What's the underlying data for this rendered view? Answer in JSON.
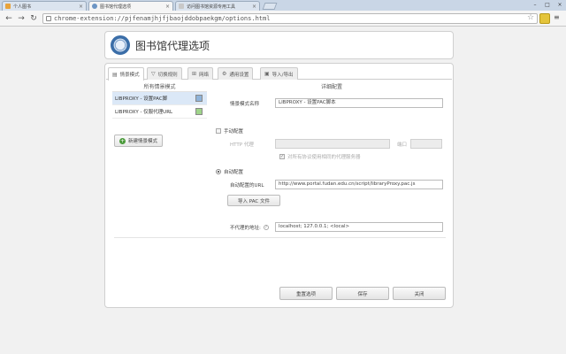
{
  "browser": {
    "tabs": [
      {
        "label": "个人图书"
      },
      {
        "label": "图书馆代理选项"
      },
      {
        "label": "访问图书馆资源专用工具"
      }
    ],
    "active_tab": 1,
    "url": "chrome-extension://pjfenamjhjfjbaojddobpaekgm/options.html"
  },
  "header": {
    "title": "图书馆代理选项"
  },
  "tabs": [
    {
      "label": "情景模式",
      "icon": "list-icon"
    },
    {
      "label": "切换规则",
      "icon": "filter-icon"
    },
    {
      "label": "网络",
      "icon": "network-icon"
    },
    {
      "label": "通用设置",
      "icon": "gear-icon"
    },
    {
      "label": "导入/导出",
      "icon": "save-icon"
    }
  ],
  "left": {
    "title": "所有情景模式",
    "profiles": [
      {
        "label": "LIBPROXY - 设置PAC脚",
        "color": "#8fb3d9"
      },
      {
        "label": "LIBPROXY - 仅服代理URL",
        "color": "#9fd48a"
      }
    ],
    "add_button": "新建情景模式"
  },
  "detail": {
    "title": "详细配置",
    "name_label": "情景模式名称",
    "name_value": "LIBPROXY - 设置PAC脚本",
    "manual_label": "手动配置",
    "http_label": "HTTP 代理",
    "port_label": "端口",
    "same_proxy_label": "对所有协议使用相同的代理服务器",
    "auto_label": "自动配置",
    "auto_url_label": "自动配置的URL",
    "auto_url_value": "http://www.portal.fudan.edu.cn/script/libraryProxy.pac.js",
    "import_pac": "导入 PAC 文件",
    "bypass_label": "不代理的地址:",
    "bypass_value": "localhost; 127.0.0.1; <local>"
  },
  "footer": {
    "reset": "重置选项",
    "save": "保存",
    "close": "关闭"
  }
}
